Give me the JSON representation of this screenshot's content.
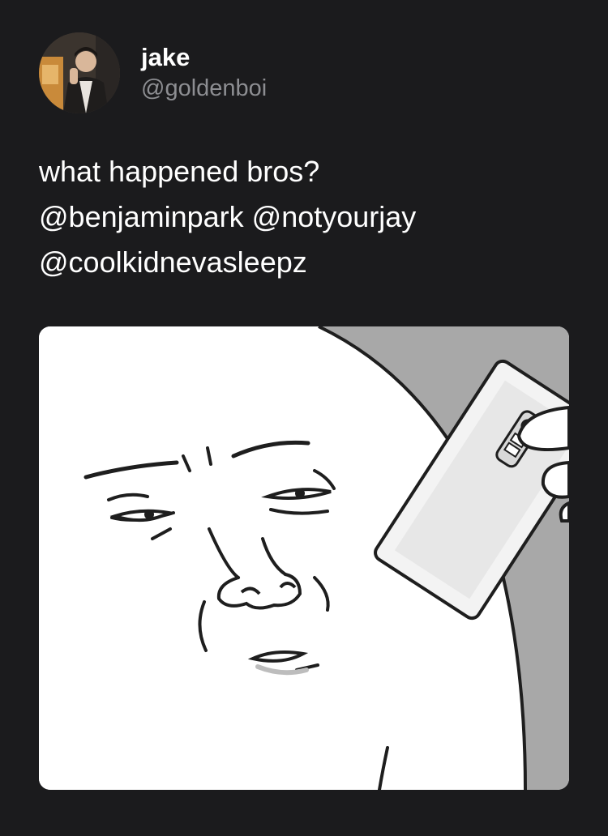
{
  "tweet": {
    "author": {
      "display_name": "jake",
      "handle": "@goldenboi",
      "avatar_icon": "profile-photo"
    },
    "text_lines": [
      "what happened bros?",
      "@benjaminpark @notyourjay",
      "@coolkidnevasleepz"
    ],
    "media": {
      "description_icon": "cartoon-face-meme-image",
      "background_color": "#a8a8a8",
      "face_color": "#ffffff"
    }
  },
  "theme": {
    "background": "#1b1b1d",
    "text": "#ffffff",
    "secondary_text": "#8d8e92"
  }
}
